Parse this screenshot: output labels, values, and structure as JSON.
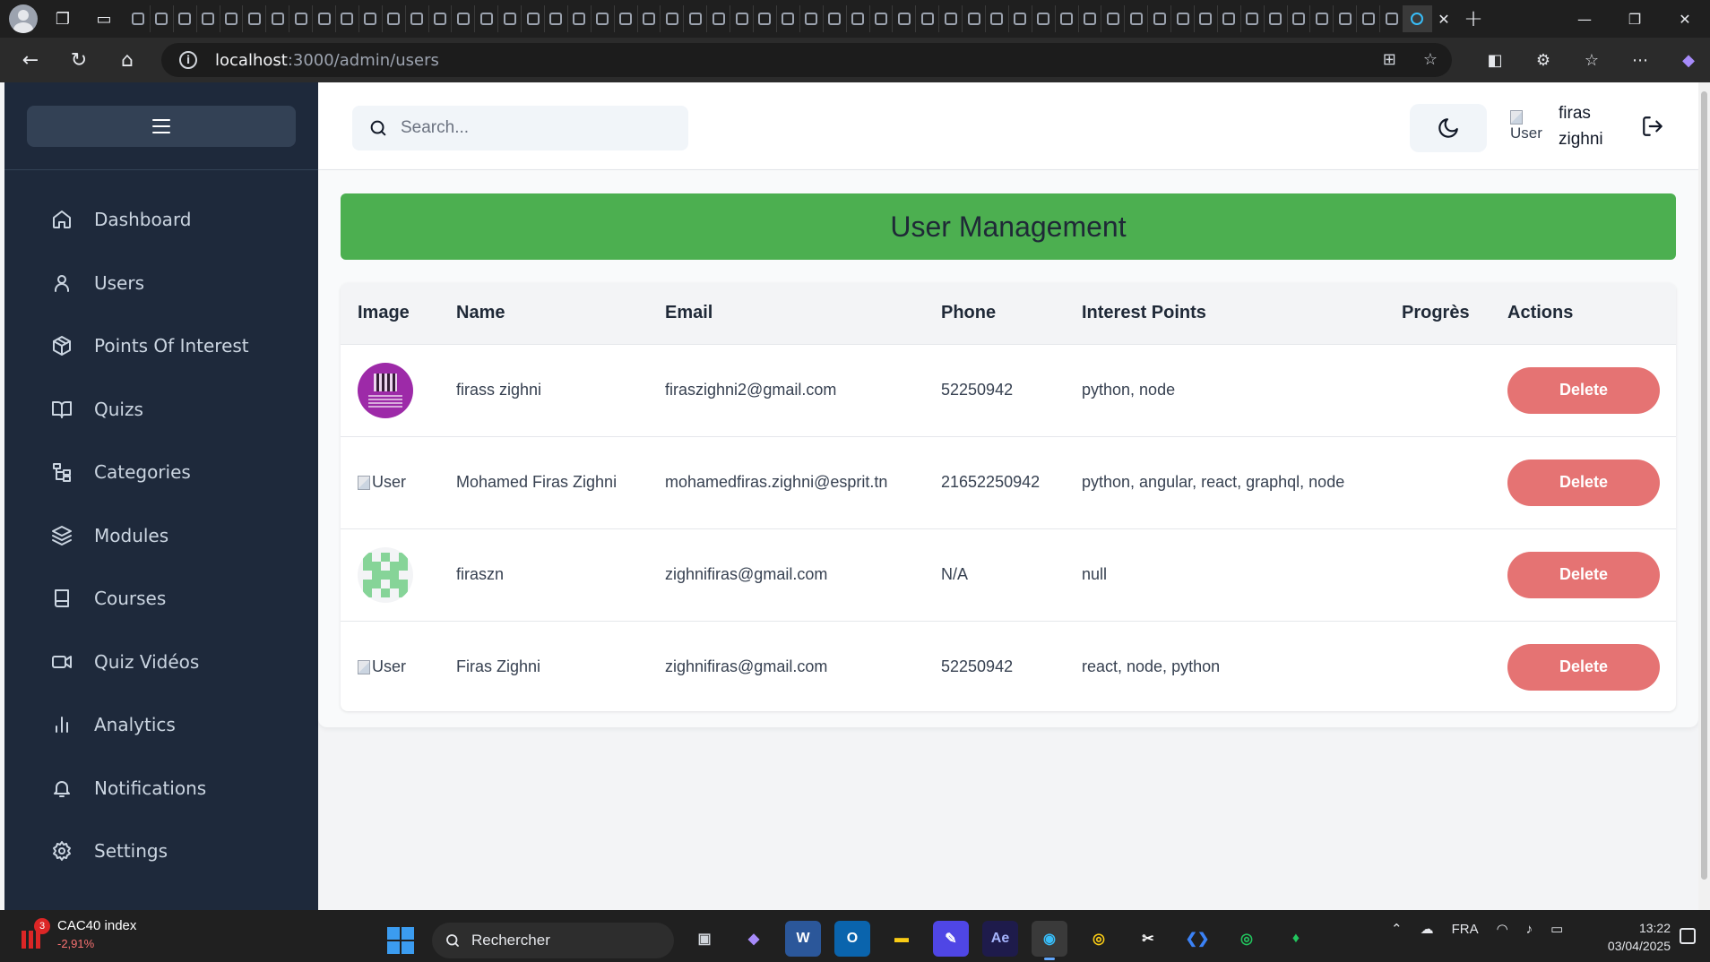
{
  "browser": {
    "url_host": "localhost",
    "url_path": ":3000/admin/users",
    "tab_count": 56
  },
  "sidebar": {
    "items": [
      {
        "label": "Dashboard",
        "icon": "home-icon"
      },
      {
        "label": "Users",
        "icon": "user-icon"
      },
      {
        "label": "Points Of Interest",
        "icon": "package-icon"
      },
      {
        "label": "Quizs",
        "icon": "book-open-icon"
      },
      {
        "label": "Categories",
        "icon": "tree-icon"
      },
      {
        "label": "Modules",
        "icon": "layers-icon"
      },
      {
        "label": "Courses",
        "icon": "book-icon"
      },
      {
        "label": "Quiz Vidéos",
        "icon": "video-icon"
      },
      {
        "label": "Analytics",
        "icon": "bar-chart-icon"
      },
      {
        "label": "Notifications",
        "icon": "bell-icon"
      },
      {
        "label": "Settings",
        "icon": "gear-icon"
      }
    ]
  },
  "header": {
    "search_placeholder": "Search...",
    "user_avatar_alt": "User",
    "user_name": "firas zighni"
  },
  "page": {
    "title": "User Management"
  },
  "table": {
    "columns": [
      "Image",
      "Name",
      "Email",
      "Phone",
      "Interest Points",
      "Progrès",
      "Actions"
    ],
    "rows": [
      {
        "image": "qr-avatar",
        "name": "firass zighni",
        "email": "firaszighni2@gmail.com",
        "phone": "52250942",
        "interests": "python, node",
        "progress": "",
        "action": "Delete"
      },
      {
        "image": "broken",
        "image_alt": "User",
        "name": "Mohamed Firas Zighni",
        "email": "mohamedfiras.zighni@esprit.tn",
        "phone": "21652250942",
        "interests": "python, angular, react, graphql, node",
        "progress": "",
        "action": "Delete"
      },
      {
        "image": "pixel-avatar",
        "name": "firaszn",
        "email": "zighnifiras@gmail.com",
        "phone": "N/A",
        "interests": "null",
        "progress": "",
        "action": "Delete"
      },
      {
        "image": "broken",
        "image_alt": "User",
        "name": "Firas Zighni",
        "email": "zighnifiras@gmail.com",
        "phone": "52250942",
        "interests": "react, node, python",
        "progress": "",
        "action": "Delete"
      }
    ]
  },
  "taskbar": {
    "widget_badge": "3",
    "widget_name": "CAC40 index",
    "widget_change": "-2,91%",
    "search_label": "Rechercher",
    "apps": [
      "copilot",
      "W",
      "O",
      "files",
      "edit",
      "Ae",
      "edge",
      "chrome-m",
      "capcut",
      "vscode",
      "chrome-f",
      "mongodb"
    ],
    "language": "FRA",
    "time": "13:22",
    "date": "03/04/2025"
  },
  "colors": {
    "sidebar_bg": "#1e293b",
    "banner_bg": "#4caf50",
    "delete_bg": "#e57373",
    "accent": "#3b9cf0"
  }
}
